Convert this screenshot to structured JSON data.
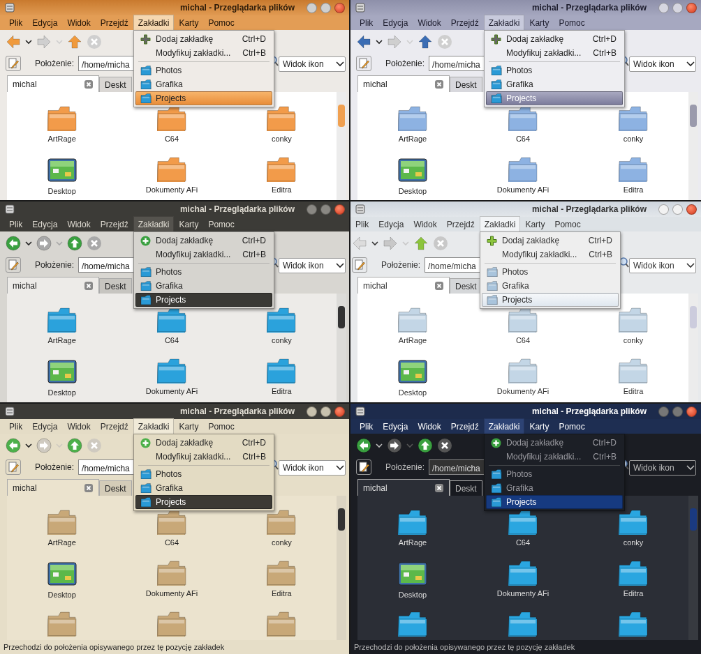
{
  "windows": [
    {
      "kind": "orange",
      "title": "michal - Przeglądarka plików",
      "menu": [
        {
          "label": "Plik",
          "selected": false
        },
        {
          "label": "Edycja",
          "selected": false
        },
        {
          "label": "Widok",
          "selected": false
        },
        {
          "label": "Przejdź",
          "selected": false
        },
        {
          "label": "Zakładki",
          "selected": true
        },
        {
          "label": "Karty",
          "selected": false
        },
        {
          "label": "Pomoc",
          "selected": false
        }
      ],
      "location_label": "Położenie:",
      "location": "/home/micha",
      "view_mode": "Widok ikon",
      "tabs": [
        {
          "label": "michal",
          "selected": true
        },
        {
          "label": "Deskt",
          "selected": false
        }
      ],
      "bookmarks_menu": {
        "actions": [
          {
            "label": "Dodaj zakładkę",
            "shortcut": "Ctrl+D"
          },
          {
            "label": "Modyfikuj zakładki...",
            "shortcut": "Ctrl+B"
          }
        ],
        "bookmarks": [
          {
            "label": "Photos",
            "selected": false
          },
          {
            "label": "Grafika",
            "selected": false
          },
          {
            "label": "Projects",
            "selected": true
          }
        ]
      },
      "files": [
        {
          "name": "ArtRage",
          "kind": "folder"
        },
        {
          "name": "C64",
          "kind": "folder"
        },
        {
          "name": "conky",
          "kind": "folder"
        },
        {
          "name": "Desktop",
          "kind": "desktop"
        },
        {
          "name": "Dokumenty AFi",
          "kind": "folder"
        },
        {
          "name": "Editra",
          "kind": "folder"
        }
      ]
    },
    {
      "kind": "steel",
      "title": "michal - Przeglądarka plików",
      "menu": [
        {
          "label": "Plik",
          "selected": false
        },
        {
          "label": "Edycja",
          "selected": false
        },
        {
          "label": "Widok",
          "selected": false
        },
        {
          "label": "Przejdź",
          "selected": false
        },
        {
          "label": "Zakładki",
          "selected": true
        },
        {
          "label": "Karty",
          "selected": false
        },
        {
          "label": "Pomoc",
          "selected": false
        }
      ],
      "location_label": "Położenie:",
      "location": "/home/micha",
      "view_mode": "Widok ikon",
      "tabs": [
        {
          "label": "michal",
          "selected": true
        },
        {
          "label": "Deskt",
          "selected": false
        }
      ],
      "bookmarks_menu": {
        "actions": [
          {
            "label": "Dodaj zakładkę",
            "shortcut": "Ctrl+D"
          },
          {
            "label": "Modyfikuj zakładki...",
            "shortcut": "Ctrl+B"
          }
        ],
        "bookmarks": [
          {
            "label": "Photos",
            "selected": false
          },
          {
            "label": "Grafika",
            "selected": false
          },
          {
            "label": "Projects",
            "selected": true
          }
        ]
      },
      "files": [
        {
          "name": "ArtRage",
          "kind": "folder"
        },
        {
          "name": "C64",
          "kind": "folder"
        },
        {
          "name": "conky",
          "kind": "folder"
        },
        {
          "name": "Desktop",
          "kind": "desktop"
        },
        {
          "name": "Dokumenty AFi",
          "kind": "folder"
        },
        {
          "name": "Editra",
          "kind": "folder"
        }
      ]
    },
    {
      "kind": "dark",
      "title": "michal - Przeglądarka plików",
      "menu": [
        {
          "label": "Plik",
          "selected": false
        },
        {
          "label": "Edycja",
          "selected": false
        },
        {
          "label": "Widok",
          "selected": false
        },
        {
          "label": "Przejdź",
          "selected": false
        },
        {
          "label": "Zakładki",
          "selected": true
        },
        {
          "label": "Karty",
          "selected": false
        },
        {
          "label": "Pomoc",
          "selected": false
        }
      ],
      "location_label": "Położenie:",
      "location": "/home/micha",
      "view_mode": "Widok ikon",
      "tabs": [
        {
          "label": "michal",
          "selected": true
        },
        {
          "label": "Deskt",
          "selected": false
        }
      ],
      "bookmarks_menu": {
        "actions": [
          {
            "label": "Dodaj zakładkę",
            "shortcut": "Ctrl+D"
          },
          {
            "label": "Modyfikuj zakładki...",
            "shortcut": "Ctrl+B"
          }
        ],
        "bookmarks": [
          {
            "label": "Photos",
            "selected": false
          },
          {
            "label": "Grafika",
            "selected": false
          },
          {
            "label": "Projects",
            "selected": true
          }
        ]
      },
      "files": [
        {
          "name": "ArtRage",
          "kind": "folder"
        },
        {
          "name": "C64",
          "kind": "folder"
        },
        {
          "name": "conky",
          "kind": "folder"
        },
        {
          "name": "Desktop",
          "kind": "desktop"
        },
        {
          "name": "Dokumenty AFi",
          "kind": "folder"
        },
        {
          "name": "Editra",
          "kind": "folder"
        }
      ]
    },
    {
      "kind": "light",
      "title": "michal - Przeglądarka plików",
      "menu": [
        {
          "label": "Plik",
          "selected": false
        },
        {
          "label": "Edycja",
          "selected": false
        },
        {
          "label": "Widok",
          "selected": false
        },
        {
          "label": "Przejdź",
          "selected": false
        },
        {
          "label": "Zakładki",
          "selected": true
        },
        {
          "label": "Karty",
          "selected": false
        },
        {
          "label": "Pomoc",
          "selected": false
        }
      ],
      "location_label": "Położenie:",
      "location": "/home/micha",
      "view_mode": "Widok ikon",
      "tabs": [
        {
          "label": "michal",
          "selected": true
        },
        {
          "label": "Deskt",
          "selected": false
        }
      ],
      "bookmarks_menu": {
        "actions": [
          {
            "label": "Dodaj zakładkę",
            "shortcut": "Ctrl+D"
          },
          {
            "label": "Modyfikuj zakładki...",
            "shortcut": "Ctrl+B"
          }
        ],
        "bookmarks": [
          {
            "label": "Photos",
            "selected": false
          },
          {
            "label": "Grafika",
            "selected": false
          },
          {
            "label": "Projects",
            "selected": true
          }
        ]
      },
      "files": [
        {
          "name": "ArtRage",
          "kind": "folder"
        },
        {
          "name": "C64",
          "kind": "folder"
        },
        {
          "name": "conky",
          "kind": "folder"
        },
        {
          "name": "Desktop",
          "kind": "desktop"
        },
        {
          "name": "Dokumenty AFi",
          "kind": "folder"
        },
        {
          "name": "Editra",
          "kind": "folder"
        }
      ]
    },
    {
      "kind": "beige",
      "title": "michal - Przeglądarka plików",
      "menu": [
        {
          "label": "Plik",
          "selected": false
        },
        {
          "label": "Edycja",
          "selected": false
        },
        {
          "label": "Widok",
          "selected": false
        },
        {
          "label": "Przejdź",
          "selected": false
        },
        {
          "label": "Zakładki",
          "selected": true
        },
        {
          "label": "Karty",
          "selected": false
        },
        {
          "label": "Pomoc",
          "selected": false
        }
      ],
      "location_label": "Położenie:",
      "location": "/home/micha",
      "view_mode": "Widok ikon",
      "tabs": [
        {
          "label": "michal",
          "selected": true
        },
        {
          "label": "Deskt",
          "selected": false
        }
      ],
      "bookmarks_menu": {
        "actions": [
          {
            "label": "Dodaj zakładkę",
            "shortcut": "Ctrl+D"
          },
          {
            "label": "Modyfikuj zakładki...",
            "shortcut": "Ctrl+B"
          }
        ],
        "bookmarks": [
          {
            "label": "Photos",
            "selected": false
          },
          {
            "label": "Grafika",
            "selected": false
          },
          {
            "label": "Projects",
            "selected": true
          }
        ]
      },
      "files": [
        {
          "name": "ArtRage",
          "kind": "folder"
        },
        {
          "name": "C64",
          "kind": "folder"
        },
        {
          "name": "conky",
          "kind": "folder"
        },
        {
          "name": "Desktop",
          "kind": "desktop"
        },
        {
          "name": "Dokumenty AFi",
          "kind": "folder"
        },
        {
          "name": "Editra",
          "kind": "folder"
        },
        {
          "kind": "folder"
        },
        {
          "kind": "folder"
        },
        {
          "kind": "folder"
        }
      ],
      "status_bar": "Przechodzi do położenia opisywanego przez tę pozycję zakładek"
    },
    {
      "kind": "navy",
      "title": "michal - Przeglądarka plików",
      "menu": [
        {
          "label": "Plik",
          "selected": false
        },
        {
          "label": "Edycja",
          "selected": false
        },
        {
          "label": "Widok",
          "selected": false
        },
        {
          "label": "Przejdź",
          "selected": false
        },
        {
          "label": "Zakładki",
          "selected": true
        },
        {
          "label": "Karty",
          "selected": false
        },
        {
          "label": "Pomoc",
          "selected": false
        }
      ],
      "location_label": "Położenie:",
      "location": "/home/micha",
      "view_mode": "Widok ikon",
      "tabs": [
        {
          "label": "michal",
          "selected": true
        },
        {
          "label": "Deskt",
          "selected": false
        }
      ],
      "bookmarks_menu": {
        "actions": [
          {
            "label": "Dodaj zakładkę",
            "shortcut": "Ctrl+D"
          },
          {
            "label": "Modyfikuj zakładki...",
            "shortcut": "Ctrl+B"
          }
        ],
        "bookmarks": [
          {
            "label": "Photos",
            "selected": false
          },
          {
            "label": "Grafika",
            "selected": false
          },
          {
            "label": "Projects",
            "selected": true
          }
        ]
      },
      "files": [
        {
          "name": "ArtRage",
          "kind": "folder"
        },
        {
          "name": "C64",
          "kind": "folder"
        },
        {
          "name": "conky",
          "kind": "folder"
        },
        {
          "name": "Desktop",
          "kind": "desktop"
        },
        {
          "name": "Dokumenty AFi",
          "kind": "folder"
        },
        {
          "name": "Editra",
          "kind": "folder"
        },
        {
          "kind": "folder"
        },
        {
          "kind": "folder"
        },
        {
          "kind": "folder"
        }
      ],
      "status_bar": "Przechodzi do położenia opisywanego przez tę pozycję zakładek"
    }
  ]
}
